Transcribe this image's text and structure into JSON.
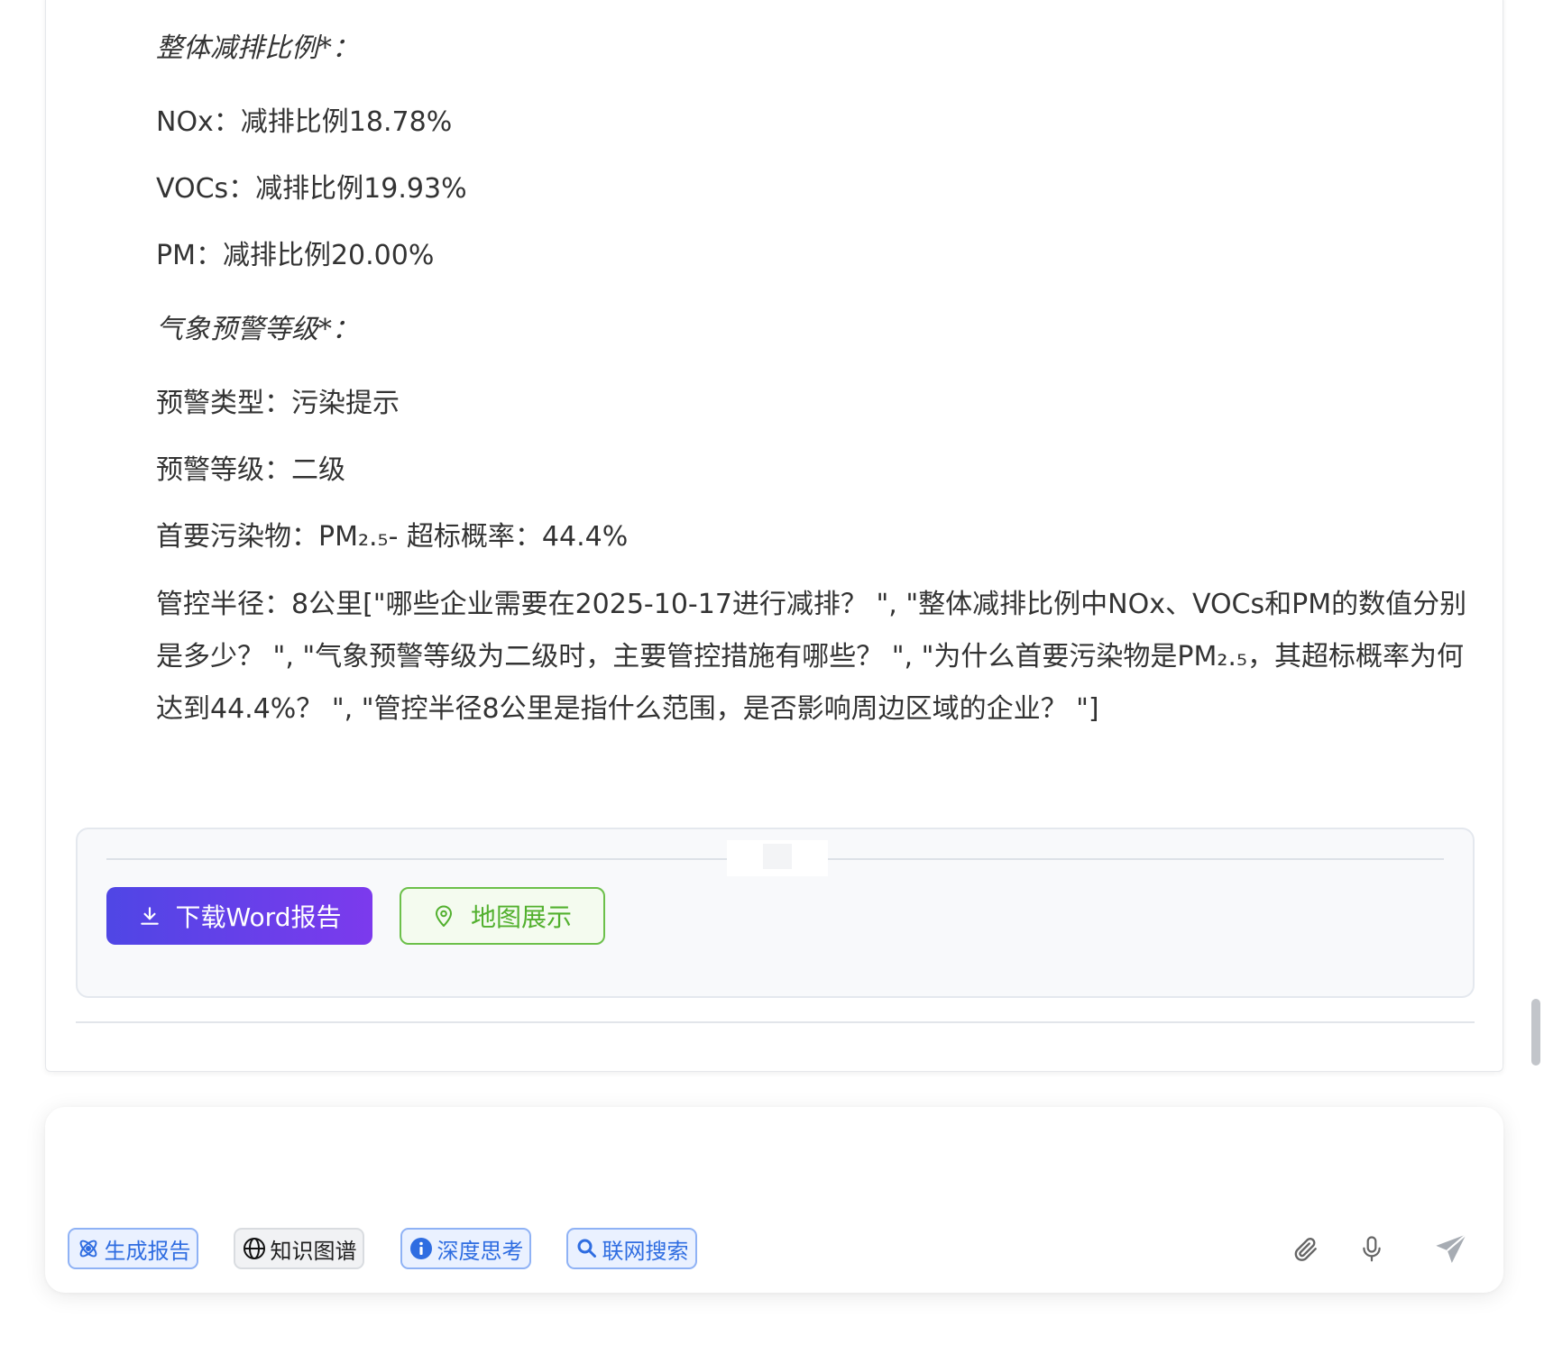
{
  "content": {
    "reduction_heading": "整体减排比例*：",
    "nox_line": "NOx：减排比例18.78%",
    "vocs_line": "VOCs：减排比例19.93%",
    "pm_line": "PM：减排比例20.00%",
    "warning_heading": "气象预警等级*：",
    "warning_type_line": "预警类型：污染提示",
    "warning_level_line": "预警等级：二级",
    "pollutant_line": "首要污染物：PM₂.₅- 超标概率：44.4%",
    "control_paragraph": "管控半径：8公里[\"哪些企业需要在2025-10-17进行减排？ \", \"整体减排比例中NOx、VOCs和PM的数值分别是多少？ \", \"气象预警等级为二级时，主要管控措施有哪些？ \", \"为什么首要污染物是PM₂.₅，其超标概率为何达到44.4%？ \", \"管控半径8公里是指什么范围，是否影响周边区域的企业？ \"]"
  },
  "actions": {
    "download_label": "下载Word报告",
    "map_label": "地图展示"
  },
  "input": {
    "value": "",
    "placeholder": ""
  },
  "chips": {
    "generate_report": "生成报告",
    "knowledge_graph": "知识图谱",
    "deep_thinking": "深度思考",
    "web_search": "联网搜索"
  },
  "colors": {
    "primary_gradient_start": "#4f46e5",
    "primary_gradient_end": "#7c3aed",
    "map_green": "#52b02e",
    "chip_blue": "#2f6de1"
  },
  "icons": {
    "download": "download-icon",
    "map": "map-pin-icon",
    "generate_report": "atom-icon",
    "knowledge_graph": "globe-icon",
    "deep_thinking": "info-icon",
    "web_search": "search-icon",
    "attach": "paperclip-icon",
    "voice": "microphone-icon",
    "send": "send-icon"
  }
}
